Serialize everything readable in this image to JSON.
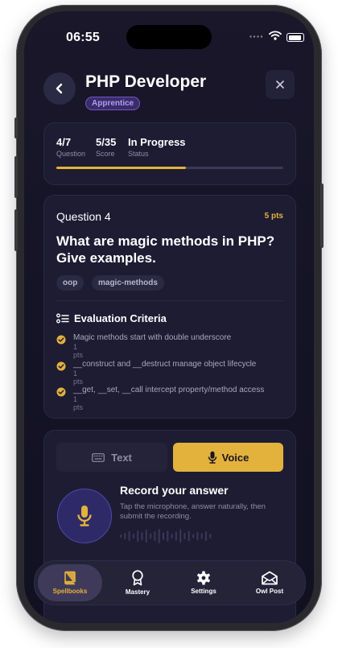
{
  "status_bar": {
    "time": "06:55"
  },
  "header": {
    "title": "PHP Developer",
    "badge": "Apprentice"
  },
  "stats": [
    {
      "value": "4/7",
      "label": "Question"
    },
    {
      "value": "5/35",
      "label": "Score"
    },
    {
      "value": "In Progress",
      "label": "Status"
    }
  ],
  "progress": {
    "fraction": 0.57
  },
  "question": {
    "label": "Question 4",
    "points": "5 pts",
    "text": "What are magic methods in PHP? Give examples.",
    "tags": [
      "oop",
      "magic-methods"
    ]
  },
  "criteria": {
    "heading": "Evaluation Criteria",
    "items": [
      {
        "text": "Magic methods start with double underscore",
        "points": "1 pts"
      },
      {
        "text": "__construct and __destruct manage object lifecycle",
        "points": "1 pts"
      },
      {
        "text": "__get, __set, __call intercept property/method access",
        "points": "1 pts"
      }
    ]
  },
  "answer": {
    "text_tab": "Text",
    "voice_tab": "Voice",
    "record_title": "Record your answer",
    "record_desc": "Tap the microphone, answer naturally, then submit the recording."
  },
  "nav": [
    {
      "label": "Spellbooks",
      "icon": "book-icon"
    },
    {
      "label": "Mastery",
      "icon": "award-icon"
    },
    {
      "label": "Settings",
      "icon": "gear-icon"
    },
    {
      "label": "Owl Post",
      "icon": "mail-icon"
    }
  ],
  "colors": {
    "accent": "#e3b23c",
    "badge": "#b09cf5",
    "background": "#161528"
  }
}
